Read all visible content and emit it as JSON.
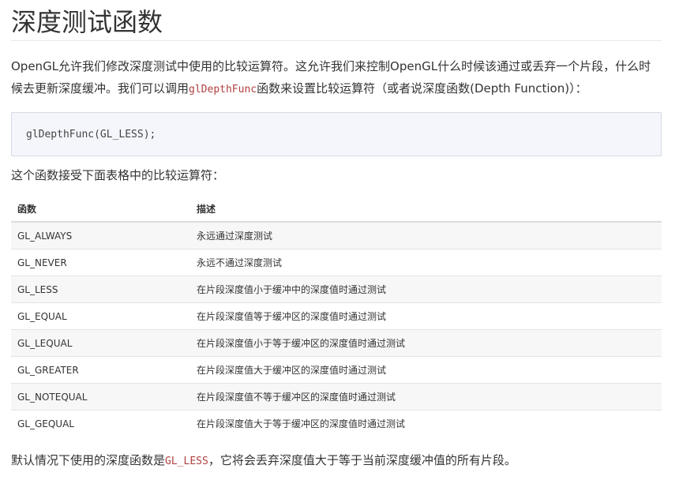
{
  "title": "深度测试函数",
  "intro": {
    "part1": "OpenGL允许我们修改深度测试中使用的比较运算符。这允许我们来控制OpenGL什么时候该通过或丢弃一个片段，什么时候去更新深度缓冲。我们可以调用",
    "code": "glDepthFunc",
    "part2": "函数来设置比较运算符（或者说深度函数(Depth Function)）："
  },
  "code_block": "glDepthFunc(GL_LESS);",
  "table_intro": "这个函数接受下面表格中的比较运算符：",
  "table": {
    "headers": [
      "函数",
      "描述"
    ],
    "rows": [
      [
        "GL_ALWAYS",
        "永远通过深度测试"
      ],
      [
        "GL_NEVER",
        "永远不通过深度测试"
      ],
      [
        "GL_LESS",
        "在片段深度值小于缓冲中的深度值时通过测试"
      ],
      [
        "GL_EQUAL",
        "在片段深度值等于缓冲区的深度值时通过测试"
      ],
      [
        "GL_LEQUAL",
        "在片段深度值小于等于缓冲区的深度值时通过测试"
      ],
      [
        "GL_GREATER",
        "在片段深度值大于缓冲区的深度值时通过测试"
      ],
      [
        "GL_NOTEQUAL",
        "在片段深度值不等于缓冲区的深度值时通过测试"
      ],
      [
        "GL_GEQUAL",
        "在片段深度值大于等于缓冲区的深度值时通过测试"
      ]
    ]
  },
  "footer": {
    "part1": "默认情况下使用的深度函数是",
    "code": "GL_LESS",
    "part2": "，它将会丢弃深度值大于等于当前深度缓冲值的所有片段。"
  }
}
